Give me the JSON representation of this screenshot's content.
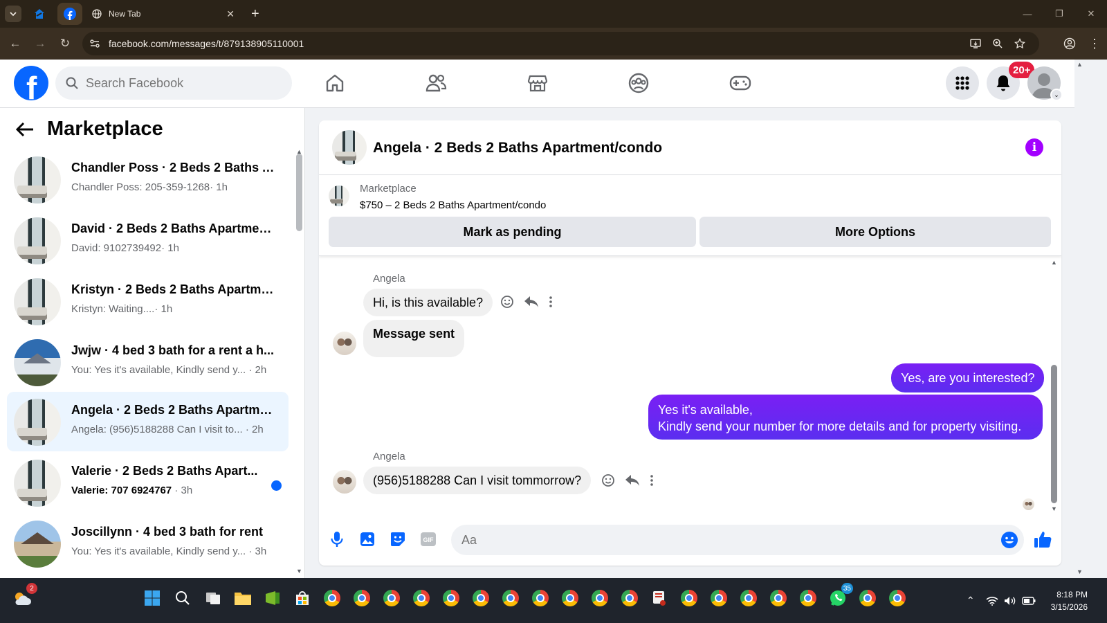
{
  "browser": {
    "tabs": [
      {
        "title": ""
      },
      {
        "title": "New Tab"
      }
    ],
    "url": "facebook.com/messages/t/879138905110001"
  },
  "fb": {
    "search_placeholder": "Search Facebook",
    "notification_badge": "20+"
  },
  "left_panel": {
    "title": "Marketplace",
    "conversations": [
      {
        "title": "Chandler Poss · 2 Beds 2 Baths A...",
        "preview": "Chandler Poss: 205-359-1268",
        "time": "· 1h",
        "thumb": "apartment-photo",
        "active": false,
        "unread": false
      },
      {
        "title": "David · 2 Beds 2 Baths Apartmen...",
        "preview": "David: 9102739492",
        "time": "· 1h",
        "thumb": "apartment-photo",
        "active": false,
        "unread": false
      },
      {
        "title": "Kristyn · 2 Beds 2 Baths Apartme...",
        "preview": "Kristyn: Waiting....",
        "time": "· 1h",
        "thumb": "apartment-photo",
        "active": false,
        "unread": false
      },
      {
        "title": "Jwjw · 4 bed 3 bath for a rent a h...",
        "preview": "You: Yes it's available, Kindly send y...",
        "time": " · 2h",
        "thumb": "house-photo",
        "active": false,
        "unread": false
      },
      {
        "title": "Angela · 2 Beds 2 Baths Apartme...",
        "preview": "Angela: (956)5188288 Can I visit to...",
        "time": " · 2h",
        "thumb": "apartment-photo",
        "active": true,
        "unread": false
      },
      {
        "title": "Valerie · 2 Beds 2 Baths Apart...",
        "preview": "Valerie: 707 6924767",
        "time": " · 3h",
        "thumb": "apartment-photo",
        "active": false,
        "unread": true
      },
      {
        "title": "Joscillynn · 4 bed 3 bath for rent",
        "preview": "You: Yes it's available, Kindly send y...",
        "time": " · 3h",
        "thumb": "house-photo",
        "active": false,
        "unread": false
      }
    ]
  },
  "chat": {
    "title": "Angela · 2 Beds 2 Baths Apartment/condo",
    "listing_label": "Marketplace",
    "listing_detail": "$750 – 2 Beds 2 Baths Apartment/condo",
    "mark_pending_label": "Mark as pending",
    "more_options_label": "More Options",
    "sender": "Angela",
    "messages": [
      {
        "from": "Angela",
        "text": "Hi, is this available?"
      },
      {
        "from": "Angela",
        "text": "Message sent"
      },
      {
        "from": "me",
        "text": "Yes, are you interested?"
      },
      {
        "from": "me",
        "line1": "Yes it's available,",
        "line2": "Kindly send your number for more details and for property visiting."
      },
      {
        "from": "Angela",
        "text": "(956)5188288 Can I visit tommorrow?"
      }
    ],
    "composer_placeholder": "Aa"
  },
  "taskbar": {
    "weather_badge": "2",
    "whatsapp_badge": "35",
    "time": "8:18 PM",
    "date": "3/15/2026"
  },
  "colors": {
    "fb_blue": "#0866ff",
    "outgoing_bubble": "#6f21f5",
    "info_purple": "#a200ff",
    "badge_red": "#e41e3f"
  }
}
